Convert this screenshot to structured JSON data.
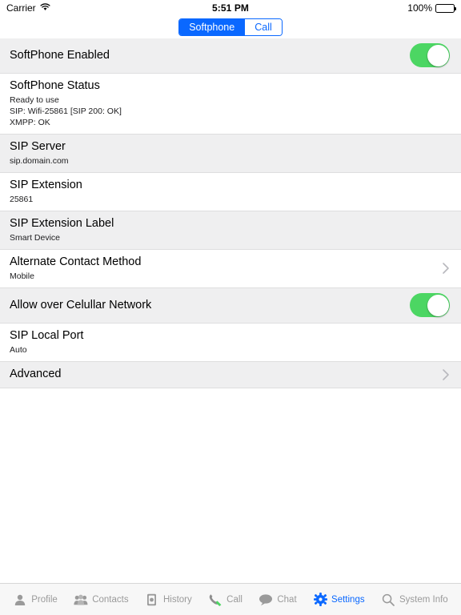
{
  "status_bar": {
    "carrier": "Carrier",
    "wifi_icon": "wifi-icon",
    "time": "5:51 PM",
    "battery_percent": "100%",
    "battery_icon": "battery-full-icon"
  },
  "segmented_control": {
    "options": [
      {
        "label": "Softphone",
        "active": true
      },
      {
        "label": "Call",
        "active": false
      }
    ],
    "active_color": "#0a68ff"
  },
  "settings_rows": [
    {
      "title": "SoftPhone Enabled",
      "sub_lines": [],
      "accessory": "toggle",
      "toggle_on": true,
      "shade": true
    },
    {
      "title": "SoftPhone Status",
      "sub_lines": [
        "Ready to use",
        "SIP: Wifi-25861 [SIP 200: OK]",
        "XMPP: OK"
      ],
      "accessory": "none",
      "shade": false
    },
    {
      "title": "SIP Server",
      "sub_lines": [
        "sip.domain.com"
      ],
      "accessory": "none",
      "shade": true
    },
    {
      "title": "SIP Extension",
      "sub_lines": [
        "25861"
      ],
      "accessory": "none",
      "shade": false
    },
    {
      "title": "SIP Extension Label",
      "sub_lines": [
        "Smart Device"
      ],
      "accessory": "none",
      "shade": true
    },
    {
      "title": "Alternate Contact Method",
      "sub_lines": [
        "Mobile"
      ],
      "accessory": "chevron",
      "shade": false
    },
    {
      "title": "Allow over Celullar Network",
      "sub_lines": [],
      "accessory": "toggle",
      "toggle_on": true,
      "shade": true
    },
    {
      "title": "SIP Local Port",
      "sub_lines": [
        "Auto"
      ],
      "accessory": "none",
      "shade": false
    },
    {
      "title": "Advanced",
      "sub_lines": [],
      "accessory": "chevron",
      "shade": true
    }
  ],
  "tabbar": {
    "items": [
      {
        "label": "Profile",
        "icon": "person-icon",
        "active": false
      },
      {
        "label": "Contacts",
        "icon": "people-icon",
        "active": false
      },
      {
        "label": "History",
        "icon": "history-icon",
        "active": false
      },
      {
        "label": "Call",
        "icon": "phone-handset-icon",
        "active": false
      },
      {
        "label": "Chat",
        "icon": "chat-bubble-icon",
        "active": false
      },
      {
        "label": "Settings",
        "icon": "gear-icon",
        "active": true
      },
      {
        "label": "System Info",
        "icon": "search-icon",
        "active": false
      }
    ],
    "active_color": "#0a68ff",
    "inactive_color": "#9a9a9a"
  }
}
